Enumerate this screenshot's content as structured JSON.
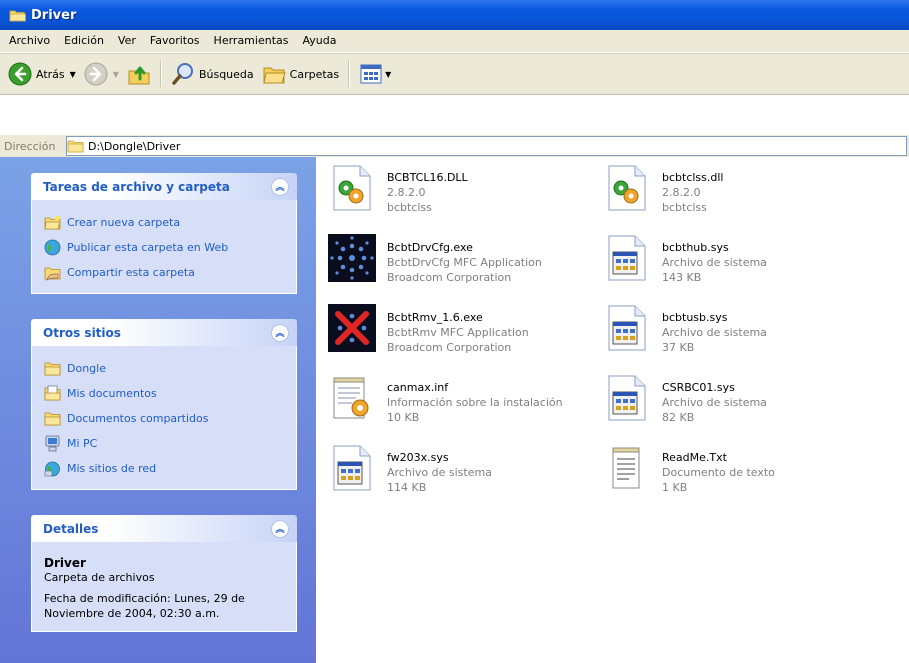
{
  "window": {
    "title": "Driver"
  },
  "menu": [
    "Archivo",
    "Edición",
    "Ver",
    "Favoritos",
    "Herramientas",
    "Ayuda"
  ],
  "toolbar": {
    "back_label": "Atrás",
    "search_label": "Búsqueda",
    "folders_label": "Carpetas"
  },
  "address": {
    "label": "Dirección",
    "path": "D:\\Dongle\\Driver"
  },
  "sidebar": {
    "tasks_panel": {
      "title": "Tareas de archivo y carpeta",
      "items": [
        {
          "label": "Crear nueva carpeta",
          "icon": "new-folder-icon"
        },
        {
          "label": "Publicar esta carpeta en Web",
          "icon": "publish-web-icon"
        },
        {
          "label": "Compartir esta carpeta",
          "icon": "share-folder-icon"
        }
      ]
    },
    "places_panel": {
      "title": "Otros sitios",
      "items": [
        {
          "label": "Dongle",
          "icon": "folder-icon"
        },
        {
          "label": "Mis documentos",
          "icon": "my-documents-icon"
        },
        {
          "label": "Documentos compartidos",
          "icon": "folder-icon"
        },
        {
          "label": "Mi PC",
          "icon": "my-computer-icon"
        },
        {
          "label": "Mis sitios de red",
          "icon": "network-places-icon"
        }
      ]
    },
    "details_panel": {
      "title": "Detalles",
      "name": "Driver",
      "type": "Carpeta de archivos",
      "modified_line1": "Fecha de modificación: Lunes, 29 de",
      "modified_line2": "Noviembre de 2004, 02:30 a.m."
    }
  },
  "files": [
    {
      "name": "BCBTCL16.DLL",
      "line2": "2.8.2.0",
      "line3": "bcbtclss",
      "icon": "dll-icon"
    },
    {
      "name": "bcbtclss.dll",
      "line2": "2.8.2.0",
      "line3": "bcbtclss",
      "icon": "dll-icon"
    },
    {
      "name": "BcbtDrvCfg.exe",
      "line2": "BcbtDrvCfg MFC Application",
      "line3": "Broadcom Corporation",
      "icon": "bluetooth-app-icon"
    },
    {
      "name": "bcbthub.sys",
      "line2": "Archivo de sistema",
      "line3": "143 KB",
      "icon": "system-file-icon"
    },
    {
      "name": "BcbtRmv_1.6.exe",
      "line2": "BcbtRmv MFC Application",
      "line3": "Broadcom Corporation",
      "icon": "remove-app-icon"
    },
    {
      "name": "bcbtusb.sys",
      "line2": "Archivo de sistema",
      "line3": "37 KB",
      "icon": "system-file-icon"
    },
    {
      "name": "canmax.inf",
      "line2": "Información sobre la instalación",
      "line3": "10 KB",
      "icon": "inf-file-icon"
    },
    {
      "name": "CSRBC01.sys",
      "line2": "Archivo de sistema",
      "line3": "82 KB",
      "icon": "system-file-icon"
    },
    {
      "name": "fw203x.sys",
      "line2": "Archivo de sistema",
      "line3": "114 KB",
      "icon": "system-file-icon"
    },
    {
      "name": "ReadMe.Txt",
      "line2": "Documento de texto",
      "line3": "1 KB",
      "icon": "text-file-icon"
    }
  ]
}
